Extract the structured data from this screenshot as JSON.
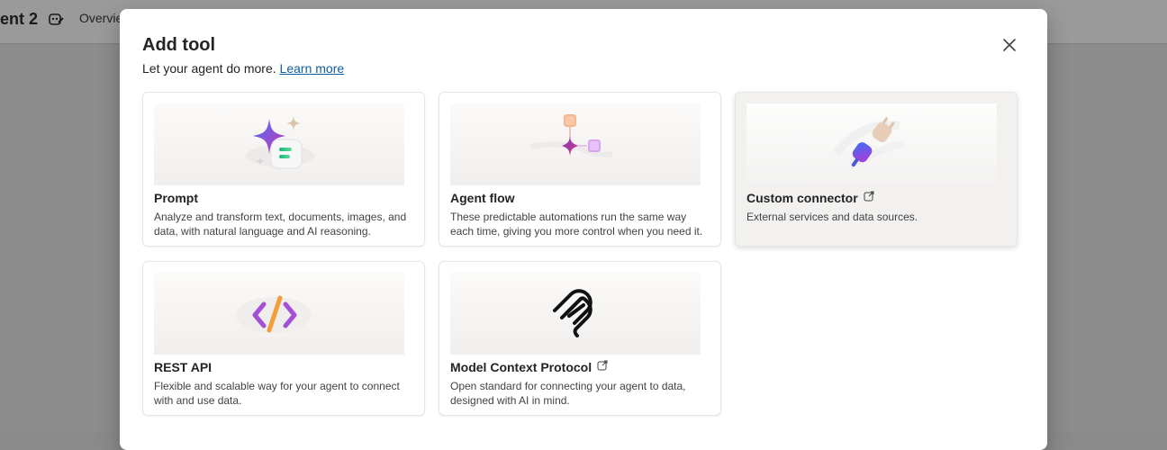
{
  "background": {
    "title": "ent 2",
    "tab_label": "Overvie"
  },
  "dialog": {
    "title": "Add tool",
    "subtitle": "Let your agent do more.",
    "learn_more": "Learn more",
    "close_icon": "close-icon"
  },
  "cards": [
    {
      "title": "Prompt",
      "description": "Analyze and transform text, documents, images, and data, with natural language and AI reasoning.",
      "icon": "sparkle-prompt-icon",
      "external": false
    },
    {
      "title": "Agent flow",
      "description": "These predictable automations run the same way each time, giving you more control when you need it.",
      "icon": "flow-icon",
      "external": false
    },
    {
      "title": "Custom connector",
      "description": "External services and data sources.",
      "icon": "plug-connector-icon",
      "external": true
    },
    {
      "title": "REST API",
      "description": "Flexible and scalable way for your agent to connect with and use data.",
      "icon": "code-brackets-icon",
      "external": false
    },
    {
      "title": "Model Context Protocol",
      "description": "Open standard for connecting your agent to data, designed with AI in mind.",
      "icon": "mcp-icon",
      "external": true
    }
  ],
  "colors": {
    "link": "#115ea3",
    "hover_card": "#f2f1f0"
  }
}
